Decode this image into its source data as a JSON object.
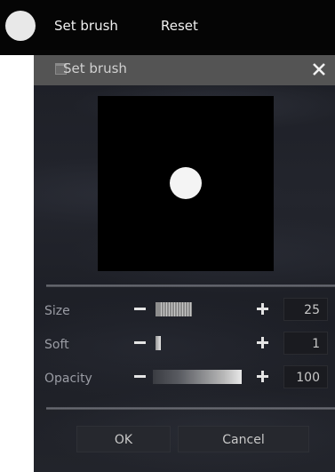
{
  "toolbar": {
    "swatch_color": "#e8e8e8",
    "set_brush_label": "Set brush",
    "reset_label": "Reset"
  },
  "dialog": {
    "title": "Set brush",
    "close_symbol": "✕",
    "preview": {
      "background": "#000000",
      "brush_color": "#f4f4f4"
    },
    "controls": {
      "size": {
        "label": "Size",
        "value": "25",
        "minus_icon": "minus-icon",
        "plus_icon": "plus-icon"
      },
      "soft": {
        "label": "Soft",
        "value": "1",
        "minus_icon": "minus-icon",
        "plus_icon": "plus-icon"
      },
      "opacity": {
        "label": "Opacity",
        "value": "100",
        "minus_icon": "minus-icon",
        "plus_icon": "plus-icon"
      }
    },
    "buttons": {
      "ok_label": "OK",
      "cancel_label": "Cancel"
    }
  }
}
